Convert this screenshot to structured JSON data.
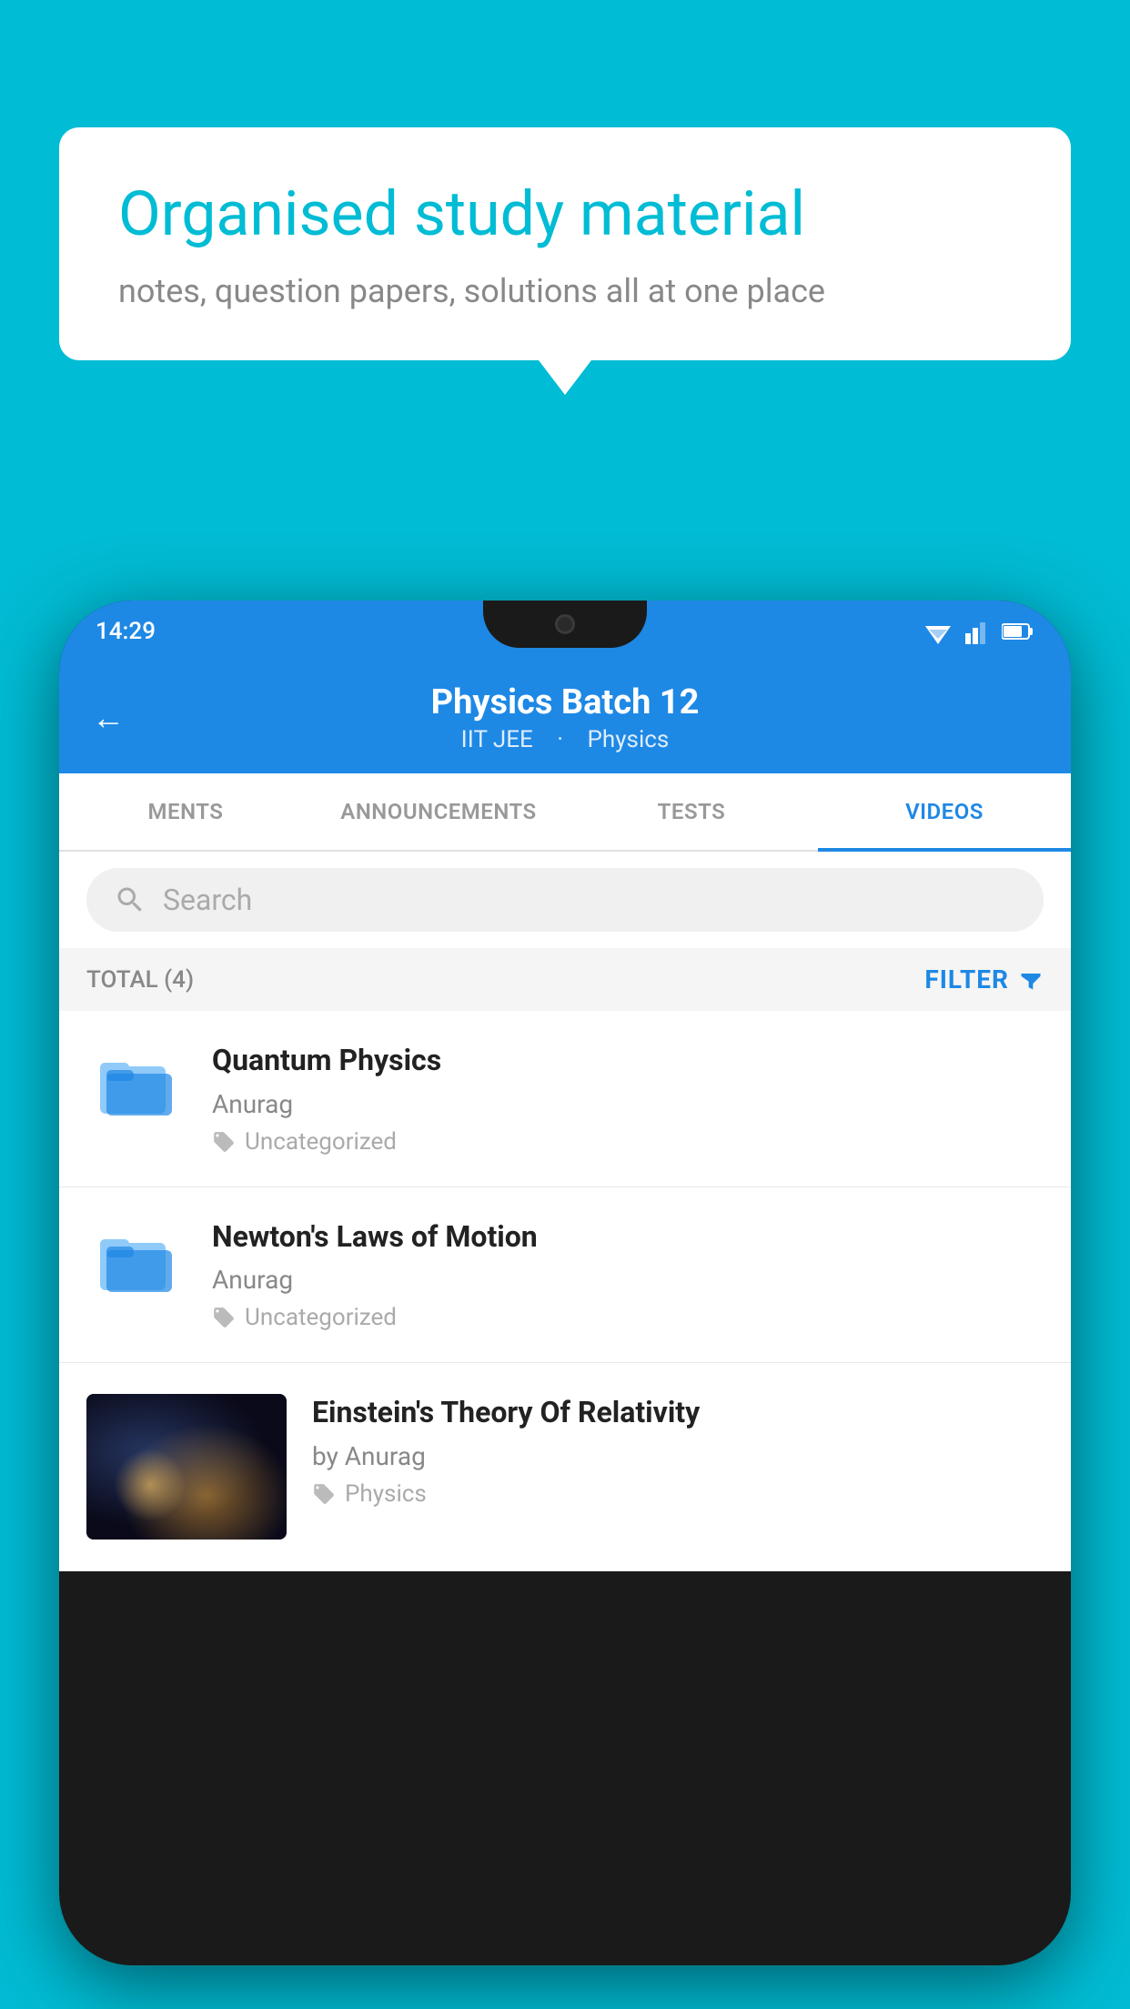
{
  "background_color": "#00bcd4",
  "bubble": {
    "title": "Organised study material",
    "subtitle": "notes, question papers, solutions all at one place"
  },
  "status_bar": {
    "time": "14:29"
  },
  "header": {
    "title": "Physics Batch 12",
    "subtitle_part1": "IIT JEE",
    "subtitle_part2": "Physics"
  },
  "tabs": [
    {
      "label": "MENTS",
      "active": false
    },
    {
      "label": "ANNOUNCEMENTS",
      "active": false
    },
    {
      "label": "TESTS",
      "active": false
    },
    {
      "label": "VIDEOS",
      "active": true
    }
  ],
  "search": {
    "placeholder": "Search"
  },
  "filter_row": {
    "total_label": "TOTAL (4)",
    "filter_label": "FILTER"
  },
  "videos": [
    {
      "id": 1,
      "title": "Quantum Physics",
      "author": "Anurag",
      "tag": "Uncategorized",
      "type": "folder"
    },
    {
      "id": 2,
      "title": "Newton's Laws of Motion",
      "author": "Anurag",
      "tag": "Uncategorized",
      "type": "folder"
    },
    {
      "id": 3,
      "title": "Einstein's Theory Of Relativity",
      "author": "by Anurag",
      "tag": "Physics",
      "type": "video"
    }
  ]
}
